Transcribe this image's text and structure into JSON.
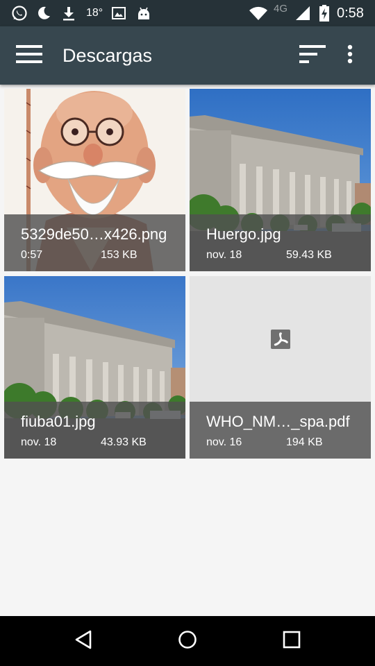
{
  "status_bar": {
    "temperature": "18°",
    "network": "4G",
    "time": "0:58",
    "icons": [
      "whatsapp-icon",
      "moon-icon",
      "download-icon",
      "image-icon",
      "android-icon",
      "wifi-icon",
      "signal-icon",
      "battery-charging-icon"
    ]
  },
  "toolbar": {
    "title": "Descargas",
    "menu_icon": "hamburger-menu-icon",
    "sort_icon": "sort-icon",
    "overflow_icon": "more-vert-icon"
  },
  "files": [
    {
      "name": "5329de50…x426.png",
      "date": "0:57",
      "size": "153 KB",
      "thumbnail": "caricature-image"
    },
    {
      "name": "Huergo.jpg",
      "date": "nov. 18",
      "size": "59.43 KB",
      "thumbnail": "building-photo"
    },
    {
      "name": "fiuba01.jpg",
      "date": "nov. 18",
      "size": "43.93 KB",
      "thumbnail": "building-photo"
    },
    {
      "name": "WHO_NM…_spa.pdf",
      "date": "nov. 16",
      "size": "194 KB",
      "thumbnail": "pdf-icon"
    }
  ],
  "nav_bar": {
    "back_icon": "back-triangle-icon",
    "home_icon": "home-circle-icon",
    "recents_icon": "recents-square-icon"
  },
  "colors": {
    "toolbar": "#37474f",
    "status_bar": "#263238",
    "background": "#f5f5f5",
    "tile_overlay": "#505050",
    "nav_bar": "#000000"
  }
}
